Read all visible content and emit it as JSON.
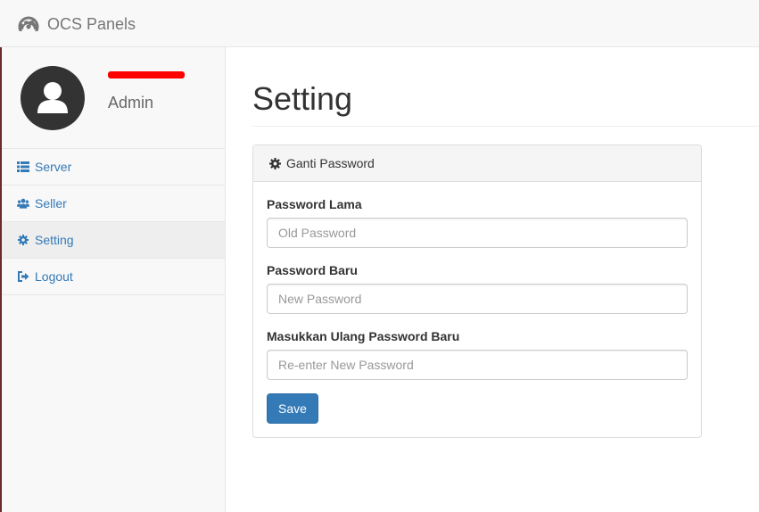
{
  "app": {
    "brand": "OCS Panels",
    "brand_icon": "dashboard-icon"
  },
  "profile": {
    "avatar_icon": "user-avatar-icon",
    "role": "Admin"
  },
  "sidebar": {
    "items": [
      {
        "label": "Server",
        "icon": "list-icon"
      },
      {
        "label": "Seller",
        "icon": "users-icon"
      },
      {
        "label": "Setting",
        "icon": "gear-icon",
        "active": true
      },
      {
        "label": "Logout",
        "icon": "logout-icon"
      }
    ]
  },
  "main": {
    "title": "Setting"
  },
  "panel": {
    "heading": "Ganti Password",
    "heading_icon": "gear-icon",
    "fields": [
      {
        "label": "Password Lama",
        "placeholder": "Old Password",
        "value": ""
      },
      {
        "label": "Password Baru",
        "placeholder": "New Password",
        "value": ""
      },
      {
        "label": "Masukkan Ulang Password Baru",
        "placeholder": "Re-enter New Password",
        "value": ""
      }
    ],
    "save_label": "Save"
  },
  "colors": {
    "link": "#337ab7",
    "primary_button": "#337ab7",
    "redaction": "#ff0000"
  }
}
